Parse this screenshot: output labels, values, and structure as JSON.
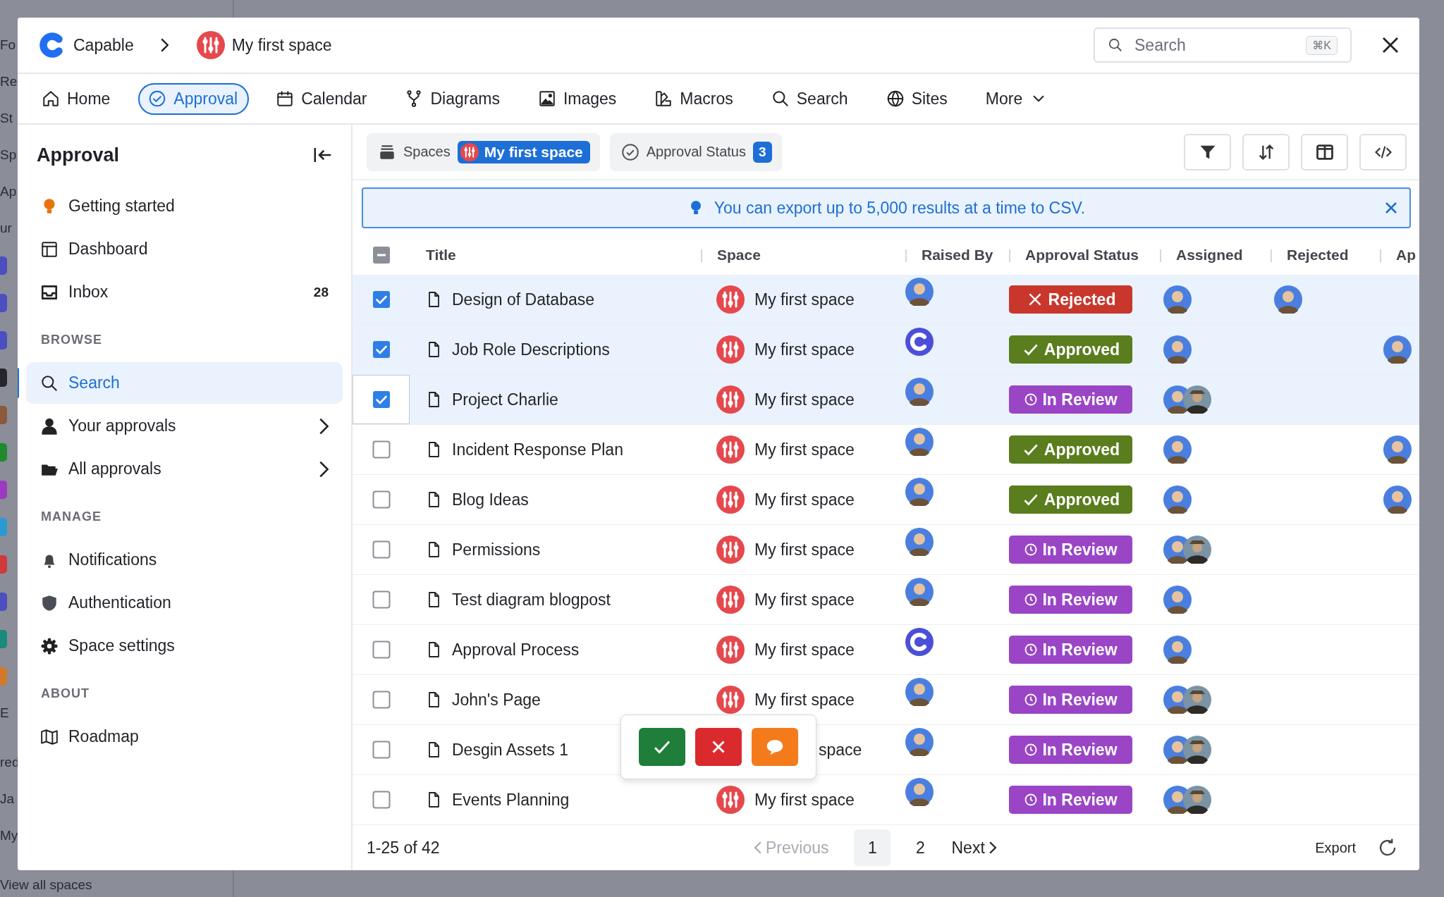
{
  "backdrop": {
    "lines": [
      {
        "kind": "text",
        "text": "Fo"
      },
      {
        "kind": "text",
        "text": "Re"
      },
      {
        "kind": "text",
        "text": "St"
      },
      {
        "kind": "text",
        "text": "Sp"
      },
      {
        "kind": "text",
        "text": "Ap"
      },
      {
        "kind": "text",
        "text": "ur"
      },
      {
        "kind": "tile",
        "color": "#4b4fc0"
      },
      {
        "kind": "tile",
        "color": "#4b4fc0"
      },
      {
        "kind": "tile",
        "color": "#4b4fc0"
      },
      {
        "kind": "tile",
        "color": "#26272d"
      },
      {
        "kind": "tile",
        "color": "#8a5a3a"
      },
      {
        "kind": "tile",
        "color": "#1f8a2e"
      },
      {
        "kind": "tile",
        "color": "#9a3ac0"
      },
      {
        "kind": "tile",
        "color": "#2a9ad0"
      },
      {
        "kind": "tile",
        "color": "#d03a3a"
      },
      {
        "kind": "tile",
        "color": "#4b4fc0"
      },
      {
        "kind": "tile",
        "color": "#1a8a7a"
      },
      {
        "kind": "tile",
        "color": "#d07a2a"
      },
      {
        "kind": "text",
        "text": "E"
      },
      {
        "kind": "text",
        "text": "red"
      },
      {
        "kind": "text",
        "text": "Ja"
      },
      {
        "kind": "text",
        "text": "My"
      },
      {
        "kind": "text",
        "text": "View all spaces"
      }
    ]
  },
  "header": {
    "app_name": "Capable",
    "space_name": "My first space",
    "search": {
      "placeholder": "Search",
      "shortcut": "⌘K"
    }
  },
  "nav": [
    {
      "label": "Home",
      "selected": false
    },
    {
      "label": "Approval",
      "selected": true
    },
    {
      "label": "Calendar",
      "selected": false
    },
    {
      "label": "Diagrams",
      "selected": false
    },
    {
      "label": "Images",
      "selected": false
    },
    {
      "label": "Macros",
      "selected": false
    },
    {
      "label": "Search",
      "selected": false
    },
    {
      "label": "Sites",
      "selected": false
    },
    {
      "label": "More",
      "selected": false
    }
  ],
  "sidebar": {
    "title": "Approval",
    "groups": [
      {
        "items": [
          {
            "label": "Getting started",
            "selected": false,
            "has_submenu": false
          },
          {
            "label": "Dashboard",
            "selected": false,
            "has_submenu": false
          },
          {
            "label": "Inbox",
            "count": "28",
            "selected": false,
            "has_submenu": false
          }
        ]
      },
      {
        "heading": "BROWSE",
        "items": [
          {
            "label": "Search",
            "selected": true,
            "has_submenu": false
          },
          {
            "label": "Your approvals",
            "selected": false,
            "has_submenu": true
          },
          {
            "label": "All approvals",
            "selected": false,
            "has_submenu": true
          }
        ]
      },
      {
        "heading": "MANAGE",
        "items": [
          {
            "label": "Notifications",
            "selected": false,
            "has_submenu": false
          },
          {
            "label": "Authentication",
            "selected": false,
            "has_submenu": false
          },
          {
            "label": "Space settings",
            "selected": false,
            "has_submenu": false
          }
        ]
      },
      {
        "heading": "ABOUT",
        "items": [
          {
            "label": "Roadmap",
            "selected": false,
            "has_submenu": false
          }
        ]
      }
    ]
  },
  "filters": [
    {
      "label": "Spaces",
      "value": "My first space"
    },
    {
      "label": "Approval Status",
      "count": "3"
    }
  ],
  "banner": {
    "text": "You can export up to 5,000 results at a time to CSV."
  },
  "table": {
    "header_checkbox": {
      "mixed": true
    },
    "columns": [
      "Title",
      "Space",
      "Raised By",
      "Approval Status",
      "Assigned",
      "Rejected",
      "Ap"
    ],
    "rows": [
      {
        "checked": true,
        "focused": false,
        "title": "Design of Database",
        "space": "My first space",
        "space_icon": true,
        "raised_by": {
          "kind": "person"
        },
        "status": {
          "kind": "rejected",
          "label": "Rejected"
        },
        "assigned": [
          {
            "kind": "person"
          }
        ],
        "rejected": [
          {
            "kind": "person"
          }
        ],
        "ap": []
      },
      {
        "checked": true,
        "focused": false,
        "title": "Job Role Descriptions",
        "space": "My first space",
        "space_icon": true,
        "raised_by": {
          "kind": "logo"
        },
        "status": {
          "kind": "approved",
          "label": "Approved"
        },
        "assigned": [
          {
            "kind": "person"
          }
        ],
        "rejected": [],
        "ap": [
          {
            "kind": "person"
          }
        ]
      },
      {
        "checked": true,
        "focused": true,
        "title": "Project Charlie",
        "space": "My first space",
        "space_icon": true,
        "raised_by": {
          "kind": "person"
        },
        "status": {
          "kind": "in_review",
          "label": "In Review"
        },
        "assigned": [
          {
            "kind": "person"
          },
          {
            "kind": "outdoor"
          }
        ],
        "rejected": [],
        "ap": []
      },
      {
        "checked": false,
        "focused": false,
        "title": "Incident Response Plan",
        "space": "My first space",
        "space_icon": true,
        "raised_by": {
          "kind": "person"
        },
        "status": {
          "kind": "approved",
          "label": "Approved"
        },
        "assigned": [
          {
            "kind": "person"
          }
        ],
        "rejected": [],
        "ap": [
          {
            "kind": "person"
          }
        ]
      },
      {
        "checked": false,
        "focused": false,
        "title": "Blog Ideas",
        "space": "My first space",
        "space_icon": true,
        "raised_by": {
          "kind": "person"
        },
        "status": {
          "kind": "approved",
          "label": "Approved"
        },
        "assigned": [
          {
            "kind": "person"
          }
        ],
        "rejected": [],
        "ap": [
          {
            "kind": "person"
          }
        ]
      },
      {
        "checked": false,
        "focused": false,
        "title": "Permissions",
        "space": "My first space",
        "space_icon": true,
        "raised_by": {
          "kind": "person"
        },
        "status": {
          "kind": "in_review",
          "label": "In Review"
        },
        "assigned": [
          {
            "kind": "person"
          },
          {
            "kind": "outdoor"
          }
        ],
        "rejected": [],
        "ap": []
      },
      {
        "checked": false,
        "focused": false,
        "title": "Test diagram blogpost",
        "space": "My first space",
        "space_icon": true,
        "raised_by": {
          "kind": "person"
        },
        "status": {
          "kind": "in_review",
          "label": "In Review"
        },
        "assigned": [
          {
            "kind": "person"
          }
        ],
        "rejected": [],
        "ap": []
      },
      {
        "checked": false,
        "focused": false,
        "title": "Approval Process",
        "space": "My first space",
        "space_icon": true,
        "raised_by": {
          "kind": "logo"
        },
        "status": {
          "kind": "in_review",
          "label": "In Review"
        },
        "assigned": [
          {
            "kind": "person"
          }
        ],
        "rejected": [],
        "ap": []
      },
      {
        "checked": false,
        "focused": false,
        "title": "John's Page",
        "space": "My first space",
        "space_icon": true,
        "raised_by": {
          "kind": "person"
        },
        "status": {
          "kind": "in_review",
          "label": "In Review"
        },
        "assigned": [
          {
            "kind": "person"
          },
          {
            "kind": "outdoor"
          }
        ],
        "rejected": [],
        "ap": []
      },
      {
        "checked": false,
        "focused": false,
        "title": "Desgin Assets 1",
        "space": "space",
        "space_icon": false,
        "raised_by": {
          "kind": "person"
        },
        "status": {
          "kind": "in_review",
          "label": "In Review"
        },
        "assigned": [
          {
            "kind": "person"
          },
          {
            "kind": "outdoor"
          }
        ],
        "rejected": [],
        "ap": []
      },
      {
        "checked": false,
        "focused": false,
        "title": "Events Planning",
        "space": "My first space",
        "space_icon": true,
        "raised_by": {
          "kind": "person"
        },
        "status": {
          "kind": "in_review",
          "label": "In Review"
        },
        "assigned": [
          {
            "kind": "person"
          },
          {
            "kind": "outdoor"
          }
        ],
        "rejected": [],
        "ap": []
      }
    ]
  },
  "footer": {
    "range": "1-25 of 42",
    "previous": {
      "label": "Previous",
      "disabled": true
    },
    "pages": [
      {
        "label": "1",
        "selected": true
      },
      {
        "label": "2",
        "selected": false
      }
    ],
    "next": {
      "label": "Next",
      "disabled": false
    },
    "export": "Export"
  }
}
